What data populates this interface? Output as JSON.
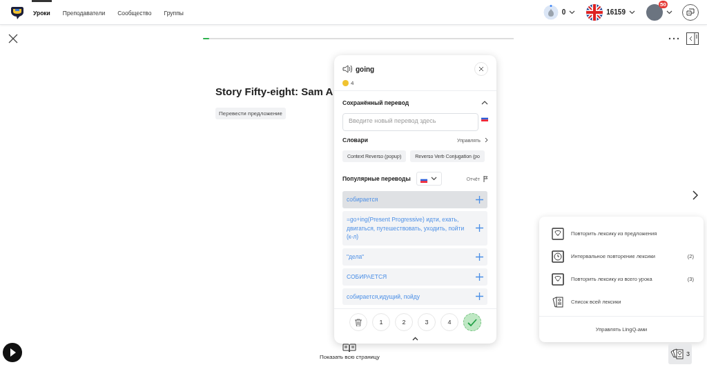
{
  "nav": {
    "items": [
      {
        "label": "Уроки",
        "selected": true
      },
      {
        "label": "Преподаватели",
        "selected": false
      },
      {
        "label": "Сообщество",
        "selected": false
      },
      {
        "label": "Группы",
        "selected": false
      }
    ]
  },
  "stats": {
    "streak": "0",
    "known_words": "16159",
    "notifications": "50"
  },
  "lesson": {
    "progress": {
      "level": 0.02
    },
    "title": "Story Fifty-eight: Sam A",
    "translate_button": "Перевести предложение",
    "show_page_button": "Показать всю страницу"
  },
  "word_popup": {
    "term": "going",
    "coins": "4",
    "saved_translation": {
      "heading": "Сохранённый перевод",
      "expanded": true,
      "placeholder": "Введите новый перевод здесь"
    },
    "dictionaries": {
      "heading": "Словари",
      "manage": "Управлять",
      "items": [
        "Context Reverso (popup)",
        "Reverso Verb Conjugation (po"
      ]
    },
    "popular": {
      "heading": "Популярные переводы",
      "report": "Отчёт",
      "items": [
        {
          "text": "собирается",
          "selected": true
        },
        {
          "text": "=go+ing(Present Progressive) идти, ехать, двигаться, путешествовать, уходить, пойти (к-л)",
          "selected": false
        },
        {
          "text": "\"дела\"",
          "selected": false
        },
        {
          "text": "СОБИРАЕТСЯ",
          "selected": false
        },
        {
          "text": "собирается,идущий, пойду",
          "selected": false
        }
      ]
    },
    "status_buttons": [
      {
        "kind": "delete",
        "selected": false
      },
      {
        "kind": "level",
        "label": "1",
        "selected": false
      },
      {
        "kind": "level",
        "label": "2",
        "selected": false
      },
      {
        "kind": "level",
        "label": "3",
        "selected": false
      },
      {
        "kind": "level",
        "label": "4",
        "selected": false
      },
      {
        "kind": "known",
        "selected": true
      }
    ]
  },
  "review_menu": {
    "items": [
      {
        "kind": "sentence",
        "label": "Повторить лексику из предложения"
      },
      {
        "kind": "srs",
        "label": "Интервальное повторение лексики",
        "count": "(2)"
      },
      {
        "kind": "lesson",
        "label": "Повторить лексику из всего урока",
        "count": "(3)"
      },
      {
        "kind": "list",
        "label": "Список всей лексики"
      }
    ],
    "manage": "Управлять LingQ-ами"
  },
  "flashcards_button": {
    "count": "3"
  }
}
